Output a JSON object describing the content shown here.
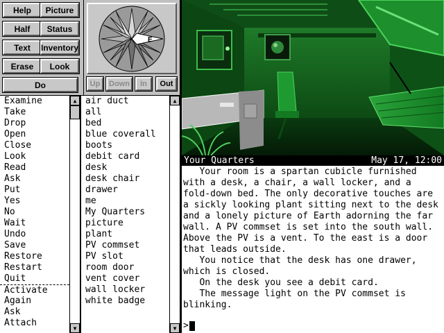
{
  "buttons": {
    "help": "Help",
    "picture": "Picture",
    "half": "Half",
    "status": "Status",
    "text": "Text",
    "inventory": "Inventory",
    "erase": "Erase",
    "look": "Look",
    "do": "Do"
  },
  "compass": {
    "label": "E",
    "directions": [
      "Up",
      "Down",
      "In",
      "Out"
    ]
  },
  "location": {
    "name": "Your Quarters",
    "datetime": "May 17, 12:00"
  },
  "verbs": [
    "Examine",
    "Take",
    "Drop",
    "Open",
    "Close",
    "Look",
    "Read",
    "Ask",
    "Put",
    "Yes",
    "No",
    "Wait",
    "Undo",
    "Save",
    "Restore",
    "Restart",
    "Quit",
    "Activate",
    "Again",
    "Ask",
    "Attach"
  ],
  "nouns": [
    "air duct",
    "all",
    "bed",
    "blue coverall",
    "boots",
    "debit card",
    "desk",
    "desk chair",
    "drawer",
    "me",
    "My Quarters",
    "picture",
    "plant",
    "PV commset",
    "PV slot",
    "room door",
    "vent cover",
    "wall locker",
    "white badge"
  ],
  "output": [
    "   Your room is a spartan cubicle furnished\nwith a desk, a chair, a wall locker, and a\nfold-down bed. The only decorative touches are\na sickly looking plant sitting next to the desk\nand a lonely picture of Earth adorning the far\nwall. A PV commset is set into the south wall.\nAbove the PV is a vent. To the east is a door\nthat leads outside.",
    "   You notice that the desk has one drawer,\nwhich is closed.",
    "   On the desk you see a debit card.",
    "   The message light on the PV commset is\nblinking."
  ],
  "prompt": ">",
  "colors": {
    "panel": "#c0c0c0",
    "scene_green": "#1f8a2a",
    "scene_dark": "#0a3a10"
  }
}
